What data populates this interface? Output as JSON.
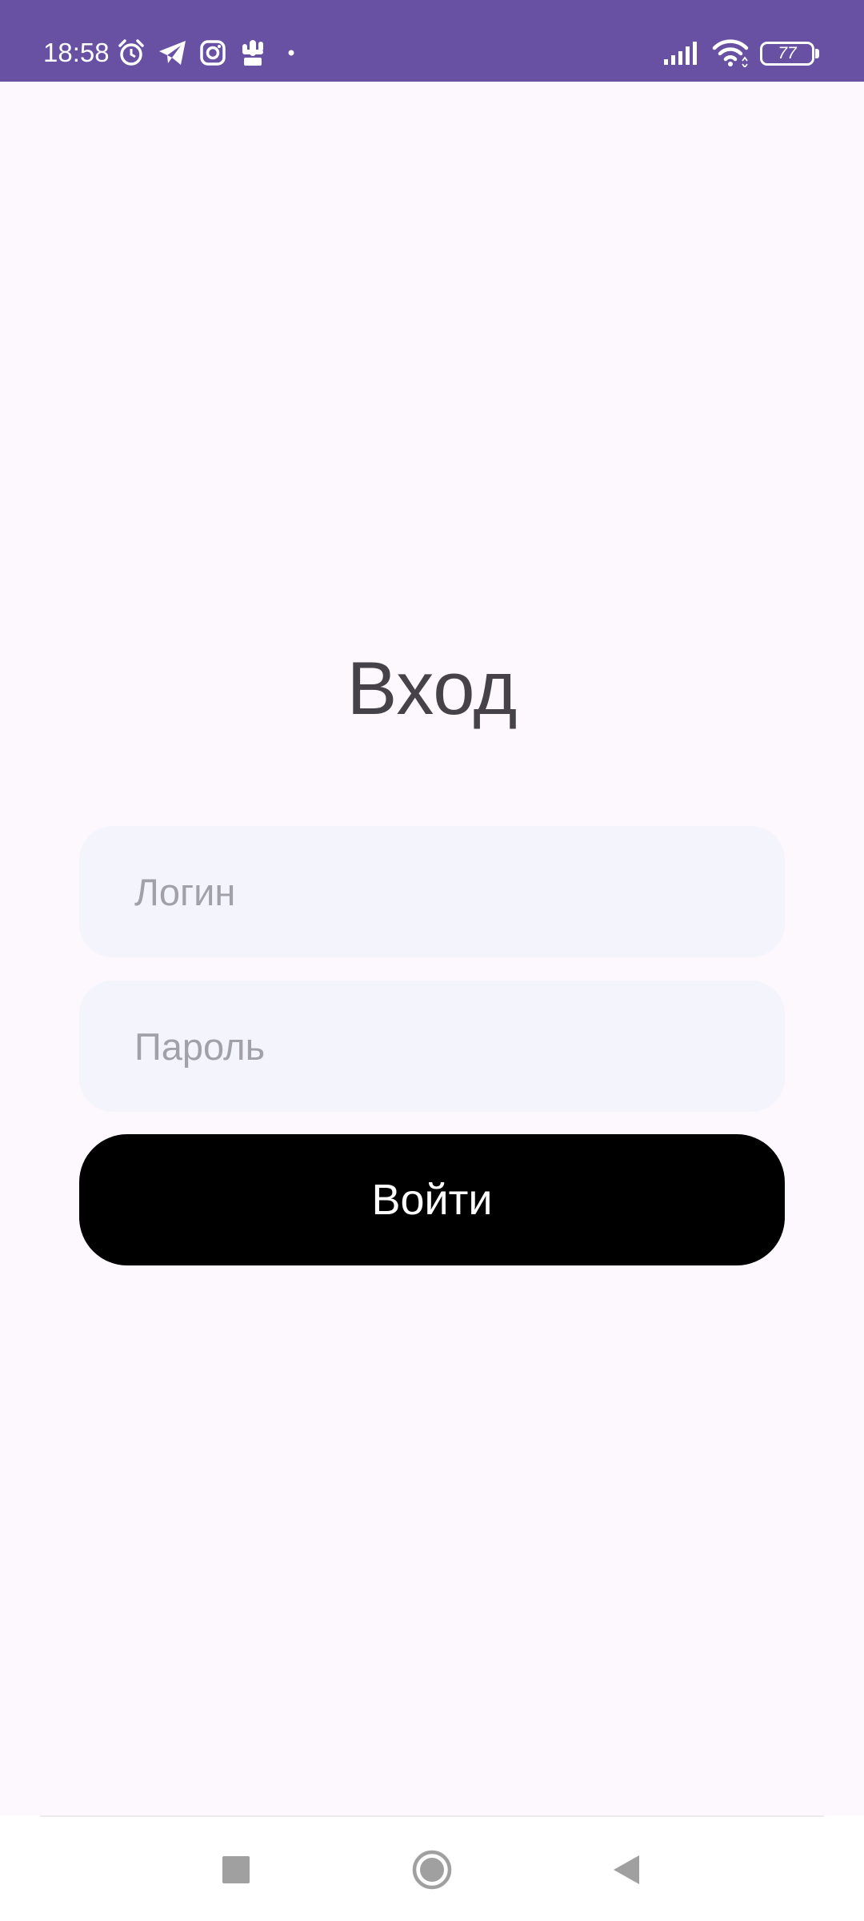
{
  "status_bar": {
    "time": "18:58",
    "battery_level": "77",
    "icons": [
      "alarm-icon",
      "telegram-icon",
      "instagram-icon",
      "cactus-icon",
      "dot-icon",
      "signal-icon",
      "wifi-icon",
      "battery-icon"
    ],
    "background": "#6851a3"
  },
  "screen": {
    "title": "Вход",
    "login": {
      "placeholder": "Логин",
      "value": ""
    },
    "password": {
      "placeholder": "Пароль",
      "value": ""
    },
    "submit_label": "Войти"
  },
  "nav_bar": {
    "icons": [
      "recents-icon",
      "home-icon",
      "back-icon"
    ]
  },
  "colors": {
    "background": "#fdf7fe",
    "field_background": "#f4f4fd",
    "button": "#000000",
    "title_text": "#454349",
    "placeholder": "#a3a1a8"
  }
}
